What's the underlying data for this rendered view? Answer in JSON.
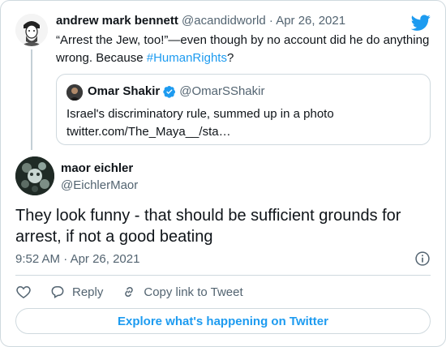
{
  "parent_tweet": {
    "author_name": "andrew mark bennett",
    "handle": "@acandidworld",
    "separator": "·",
    "date": "Apr 26, 2021",
    "text_before_hashtag": "“Arrest the Jew, too!”—even though by no account did he do anything wrong. Because ",
    "hashtag": "#HumanRights",
    "text_after_hashtag": "?"
  },
  "quoted_tweet": {
    "author_name": "Omar Shakir",
    "handle": "@OmarSShakir",
    "text_line1": "Israel's discriminatory rule, summed up in a photo",
    "text_line2": "twitter.com/The_Maya__/sta…"
  },
  "main_tweet": {
    "author_name": "maor eichler",
    "handle": "@EichlerMaor",
    "text": "They look funny - that should be sufficient grounds for arrest, if not a good beating",
    "time": "9:52 AM",
    "separator": "·",
    "date": "Apr 26, 2021"
  },
  "actions": {
    "reply_label": "Reply",
    "copy_link_label": "Copy link to Tweet"
  },
  "explore_label": "Explore what's happening on Twitter",
  "colors": {
    "accent": "#1d9bf0",
    "text": "#0f1419",
    "muted": "#536471",
    "border": "#cfd9de"
  }
}
